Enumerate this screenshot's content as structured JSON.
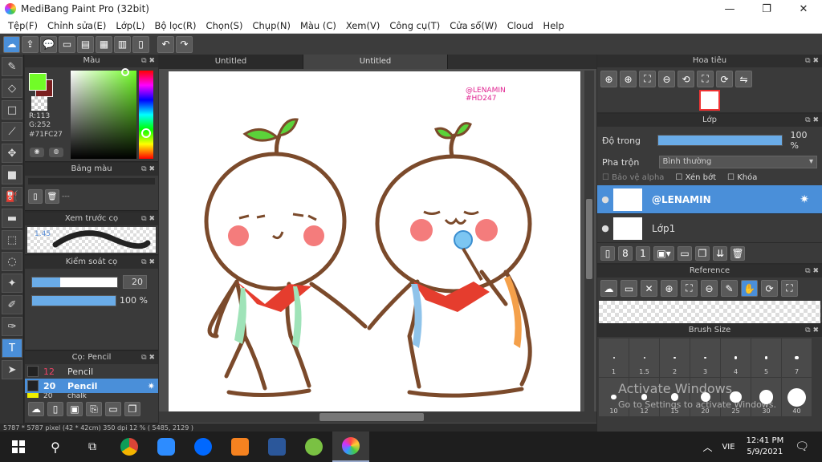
{
  "window": {
    "title": "MediBang Paint Pro (32bit)",
    "min": "—",
    "max": "❐",
    "close": "✕"
  },
  "menu": [
    "Tệp(F)",
    "Chỉnh sửa(E)",
    "Lớp(L)",
    "Bộ lọc(R)",
    "Chọn(S)",
    "Chụp(N)",
    "Màu (C)",
    "Xem(V)",
    "Công cụ(T)",
    "Cửa sổ(W)",
    "Cloud",
    "Help"
  ],
  "color_panel": {
    "title": "Màu",
    "r": "R:113",
    "g": "G:252",
    "hex": "#71FC27",
    "fg": "#71fc27"
  },
  "palette_panel": {
    "title": "Bảng màu",
    "placeholder": "---"
  },
  "brush_preview": {
    "title": "Xem trước cọ",
    "size": "1.45"
  },
  "brush_control": {
    "title": "Kiểm soát cọ",
    "size_value": "20",
    "opacity_value": "100 %",
    "size_level": 0.33,
    "opacity_level": 1.0
  },
  "brush_list": {
    "title": "Cọ: Pencil",
    "items": [
      {
        "size": "12",
        "name": "Pencil"
      },
      {
        "size": "20",
        "name": "Pencil"
      },
      {
        "size": "20",
        "name": "chalk"
      }
    ]
  },
  "tabs": [
    "Untitled",
    "Untitled"
  ],
  "canvas_text": {
    "tag1": "@LENAMIN",
    "tag2": "#HD247"
  },
  "status": "5787 * 5787 pixel   (42 * 42cm)   350 dpi   12 %   ( 5485, 2129 )",
  "navigator": {
    "title": "Hoa tiêu"
  },
  "layer_panel": {
    "title": "Lớp",
    "opacity_label": "Độ trong",
    "opacity_value": "100 %",
    "opacity_level": 1.0,
    "blend_label": "Pha trộn",
    "blend_value": "Bình thường",
    "protect_alpha": "Bảo vệ alpha",
    "clipping": "Xén bớt",
    "lock": "Khóa",
    "layers": [
      {
        "name": "@LENAMIN",
        "selected": true
      },
      {
        "name": "Lớp1",
        "selected": false
      }
    ]
  },
  "reference_panel": {
    "title": "Reference"
  },
  "brush_size_panel": {
    "title": "Brush Size",
    "sizes": [
      "1",
      "1.5",
      "2",
      "3",
      "4",
      "5",
      "7",
      "10",
      "12",
      "15",
      "20",
      "25",
      "30",
      "40"
    ]
  },
  "watermark": {
    "line1": "Activate Windows",
    "line2": "Go to Settings to activate Windows."
  },
  "taskbar": {
    "lang": "VIE",
    "time": "12:41 PM",
    "date": "5/9/2021"
  }
}
